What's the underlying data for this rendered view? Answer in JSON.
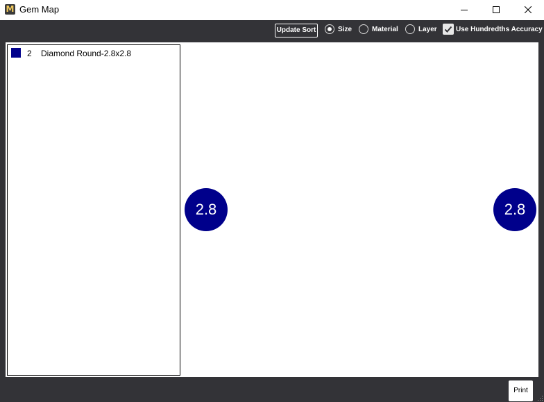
{
  "window": {
    "title": "Gem Map",
    "app_icon_letter": "M"
  },
  "toolbar": {
    "update_sort_label": "Update Sort",
    "sort_options": [
      {
        "label": "Size",
        "checked": true
      },
      {
        "label": "Material",
        "checked": false
      },
      {
        "label": "Layer",
        "checked": false
      }
    ],
    "hundredths_label": "Use Hundredths Accuracy",
    "hundredths_checked": true
  },
  "gem_list": [
    {
      "count": "2",
      "name": "Diamond Round-2.8x2.8",
      "color": "#00008b"
    }
  ],
  "gems": [
    {
      "label": "2.8",
      "color": "#00008b"
    },
    {
      "label": "2.8",
      "color": "#00008b"
    }
  ],
  "footer": {
    "print_label": "Print"
  },
  "colors": {
    "chrome": "#333337",
    "gem": "#00008b"
  }
}
